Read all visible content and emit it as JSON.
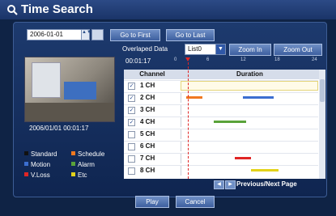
{
  "window": {
    "title": "Time Search"
  },
  "date_picker": {
    "value": "2006-01-01",
    "spin": "▲▼"
  },
  "toolbar": {
    "go_first": "Go to First",
    "go_last": "Go to Last",
    "zoom_in": "Zoom In",
    "zoom_out": "Zoom Out"
  },
  "overlap": {
    "label": "Overlaped Data",
    "value": "List0"
  },
  "timeline": {
    "current_time": "00:01:17",
    "ticks": [
      "0",
      "6",
      "12",
      "18",
      "24"
    ]
  },
  "preview": {
    "timestamp": "2006/01/01  00:01:17"
  },
  "grid": {
    "headers": {
      "channel": "Channel",
      "duration": "Duration"
    },
    "rows": [
      {
        "label": "1 CH",
        "checked": true
      },
      {
        "label": "2 CH",
        "checked": true
      },
      {
        "label": "3 CH",
        "checked": true
      },
      {
        "label": "4 CH",
        "checked": true
      },
      {
        "label": "5 CH",
        "checked": false
      },
      {
        "label": "6 CH",
        "checked": false
      },
      {
        "label": "7 CH",
        "checked": false
      },
      {
        "label": "8 CH",
        "checked": false
      }
    ]
  },
  "legend": {
    "standard": "Standard",
    "schedule": "Schedule",
    "motion": "Motion",
    "alarm": "Alarm",
    "vloss": "V.Loss",
    "etc": "Etc"
  },
  "colors": {
    "standard": "#111111",
    "schedule": "#f07820",
    "motion": "#3b6ed0",
    "alarm": "#5aa33a",
    "vloss": "#e02525",
    "etc": "#e3d21a"
  },
  "pagination": {
    "label": "Previous/Next Page"
  },
  "footer": {
    "play": "Play",
    "cancel": "Cancel"
  }
}
